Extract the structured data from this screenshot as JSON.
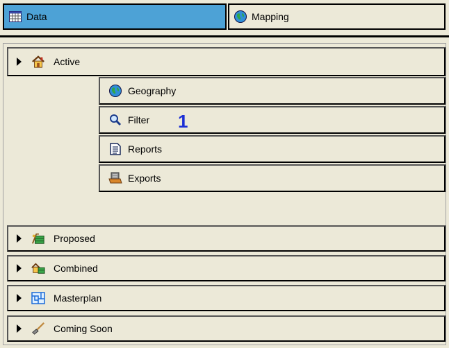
{
  "tabs": [
    {
      "label": "Data",
      "icon": "grid-icon",
      "active": true
    },
    {
      "label": "Mapping",
      "icon": "globe-icon",
      "active": false
    }
  ],
  "categories": {
    "active": {
      "label": "Active",
      "icon": "house-icon",
      "expanded": true
    },
    "proposed": {
      "label": "Proposed",
      "icon": "proposed-icon"
    },
    "combined": {
      "label": "Combined",
      "icon": "combined-icon"
    },
    "masterplan": {
      "label": "Masterplan",
      "icon": "masterplan-icon"
    },
    "coming_soon": {
      "label": "Coming Soon",
      "icon": "shovel-icon"
    }
  },
  "active_subitems": [
    {
      "label": "Geography",
      "icon": "globe-icon"
    },
    {
      "label": "Filter",
      "icon": "magnifier-icon"
    },
    {
      "label": "Reports",
      "icon": "report-icon"
    },
    {
      "label": "Exports",
      "icon": "export-icon"
    }
  ],
  "annotation": "1",
  "colors": {
    "active_tab": "#4da2d6",
    "background": "#ece9d8",
    "annotation": "#1c2fd6"
  }
}
